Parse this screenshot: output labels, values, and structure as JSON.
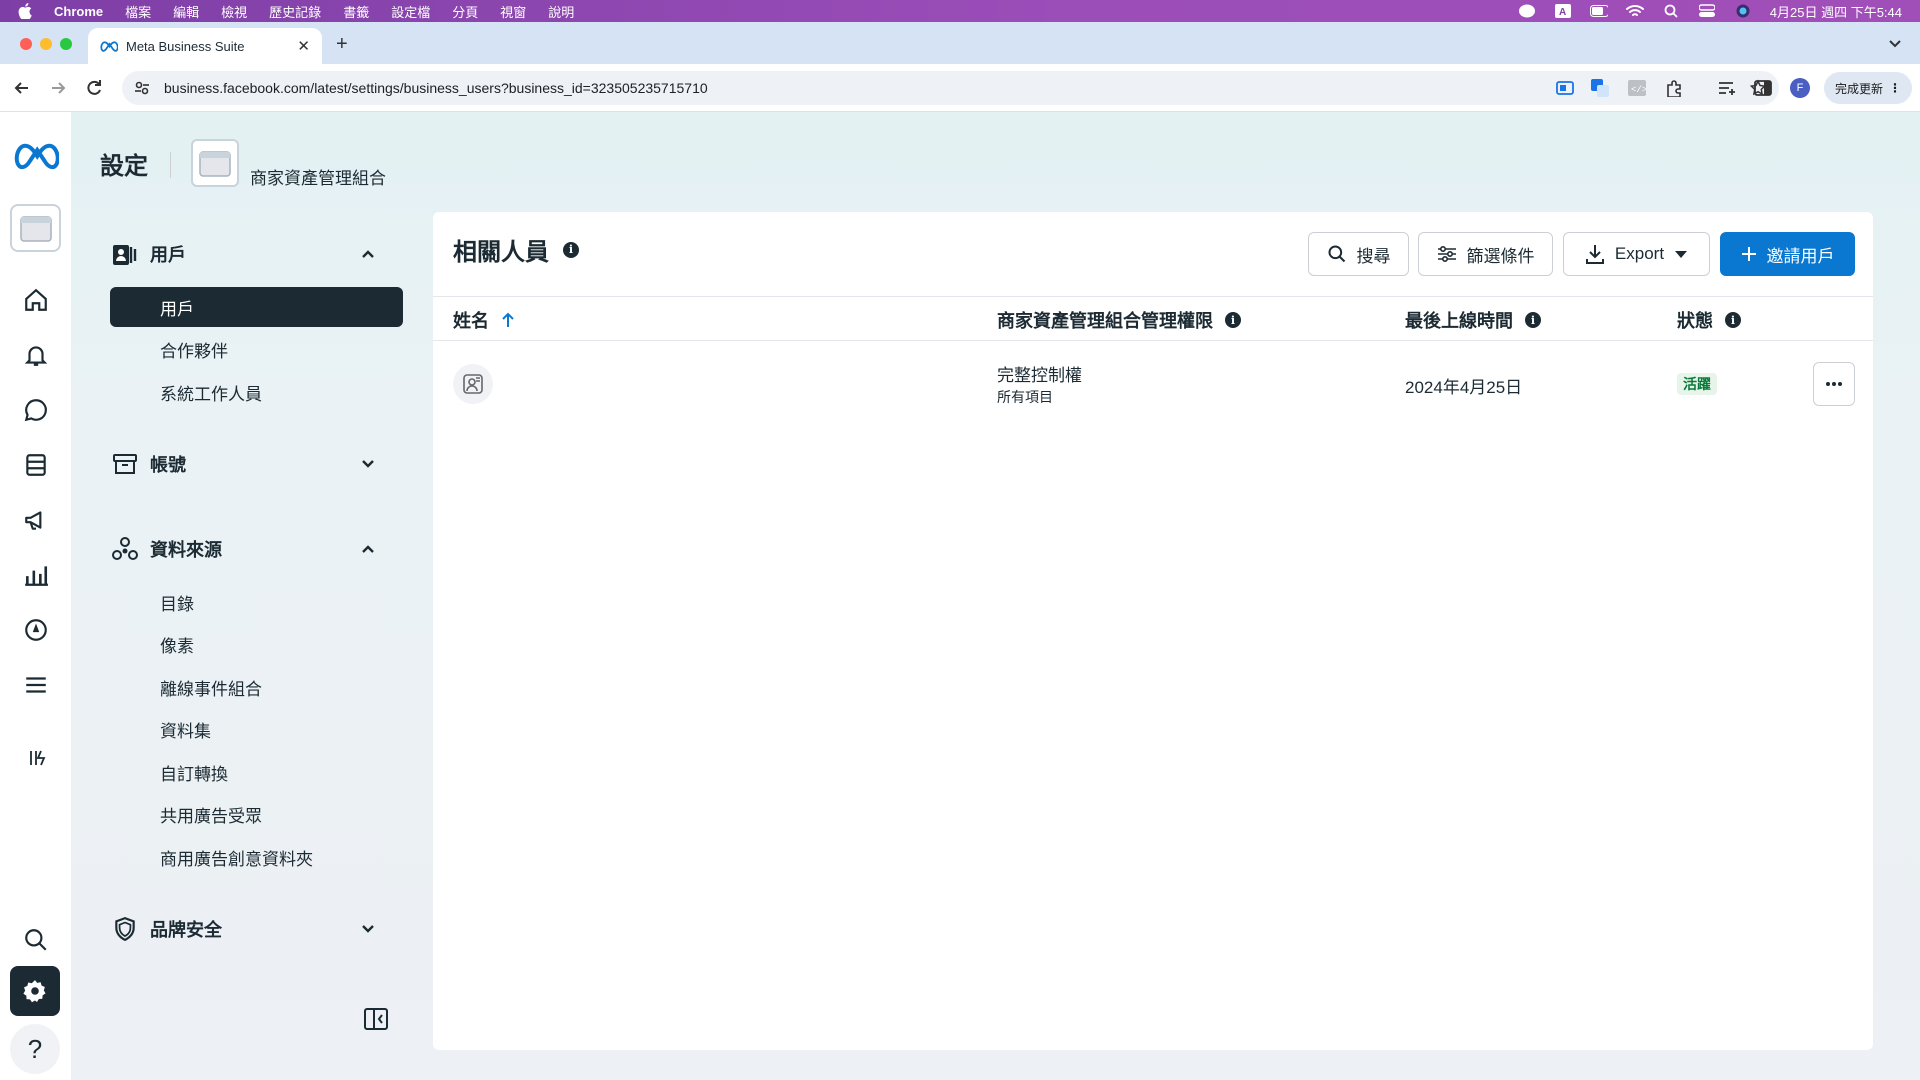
{
  "menubar": {
    "app": "Chrome",
    "items": [
      "檔案",
      "編輯",
      "檢視",
      "歷史記錄",
      "書籤",
      "設定檔",
      "分頁",
      "視窗",
      "說明"
    ],
    "clock": "4月25日 週四 下午5:44"
  },
  "browser": {
    "tab_title": "Meta Business Suite",
    "url": "business.facebook.com/latest/settings/business_users?business_id=323505235715710",
    "update_label": "完成更新",
    "profile_initial": "F"
  },
  "page": {
    "title": "設定",
    "business_name": "商家資產管理組合"
  },
  "sidebar": {
    "users": {
      "label": "用戶",
      "items": [
        "用戶",
        "合作夥伴",
        "系統工作人員"
      ]
    },
    "accounts": {
      "label": "帳號"
    },
    "data_sources": {
      "label": "資料來源",
      "items": [
        "目錄",
        "像素",
        "離線事件組合",
        "資料集",
        "自訂轉換",
        "共用廣告受眾",
        "商用廣告創意資料夾"
      ]
    },
    "brand_safety": {
      "label": "品牌安全"
    }
  },
  "main": {
    "title": "相關人員",
    "search_label": "搜尋",
    "filter_label": "篩選條件",
    "export_label": "Export",
    "invite_label": "邀請用戶",
    "columns": {
      "name": "姓名",
      "permission": "商家資產管理組合管理權限",
      "last_active": "最後上線時間",
      "status": "狀態"
    },
    "rows": [
      {
        "permission": "完整控制權",
        "permission_scope": "所有項目",
        "last_active": "2024年4月25日",
        "status": "活躍"
      }
    ]
  },
  "colors": {
    "primary": "#0a78d1",
    "dark": "#1c2b33",
    "status_active": "#0a7a3a"
  }
}
